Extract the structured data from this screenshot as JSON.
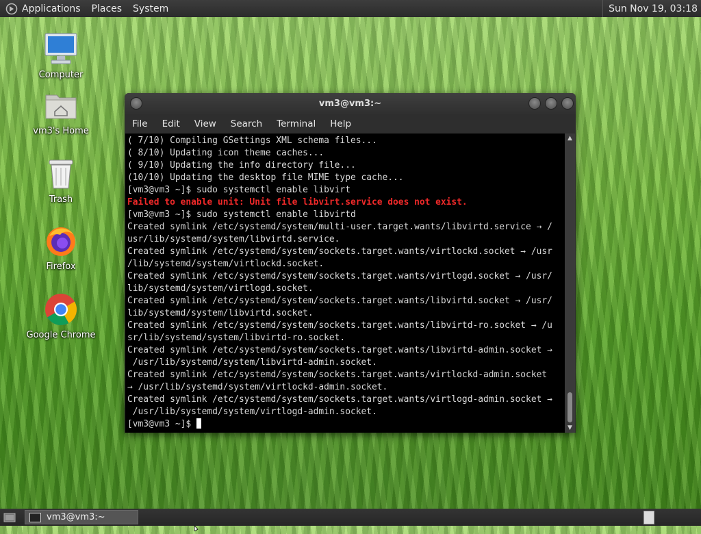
{
  "top_panel": {
    "menus": [
      "Applications",
      "Places",
      "System"
    ],
    "clock": "Sun Nov 19, 03:18"
  },
  "desktop": {
    "icons": [
      {
        "label": "Computer",
        "icon": "computer-icon"
      },
      {
        "label": "vm3's Home",
        "icon": "home-folder-icon"
      },
      {
        "label": "Trash",
        "icon": "trash-icon"
      },
      {
        "label": "Firefox",
        "icon": "firefox-icon"
      },
      {
        "label": "Google Chrome",
        "icon": "chrome-icon"
      }
    ]
  },
  "terminal": {
    "title": "vm3@vm3:~",
    "menus": [
      "File",
      "Edit",
      "View",
      "Search",
      "Terminal",
      "Help"
    ],
    "lines": [
      "( 7/10) Compiling GSettings XML schema files...",
      "( 8/10) Updating icon theme caches...",
      "( 9/10) Updating the info directory file...",
      "(10/10) Updating the desktop file MIME type cache...",
      "[vm3@vm3 ~]$ sudo systemctl enable libvirt",
      "Failed to enable unit: Unit file libvirt.service does not exist.",
      "[vm3@vm3 ~]$ sudo systemctl enable libvirtd",
      "Created symlink /etc/systemd/system/multi-user.target.wants/libvirtd.service → /",
      "usr/lib/systemd/system/libvirtd.service.",
      "Created symlink /etc/systemd/system/sockets.target.wants/virtlockd.socket → /usr",
      "/lib/systemd/system/virtlockd.socket.",
      "Created symlink /etc/systemd/system/sockets.target.wants/virtlogd.socket → /usr/",
      "lib/systemd/system/virtlogd.socket.",
      "Created symlink /etc/systemd/system/sockets.target.wants/libvirtd.socket → /usr/",
      "lib/systemd/system/libvirtd.socket.",
      "Created symlink /etc/systemd/system/sockets.target.wants/libvirtd-ro.socket → /u",
      "sr/lib/systemd/system/libvirtd-ro.socket.",
      "Created symlink /etc/systemd/system/sockets.target.wants/libvirtd-admin.socket →",
      " /usr/lib/systemd/system/libvirtd-admin.socket.",
      "Created symlink /etc/systemd/system/sockets.target.wants/virtlockd-admin.socket",
      "→ /usr/lib/systemd/system/virtlockd-admin.socket.",
      "Created symlink /etc/systemd/system/sockets.target.wants/virtlogd-admin.socket →",
      " /usr/lib/systemd/system/virtlogd-admin.socket."
    ],
    "error_line_index": 5,
    "prompt": "[vm3@vm3 ~]$ "
  },
  "taskbar": {
    "window_label": "vm3@vm3:~"
  }
}
